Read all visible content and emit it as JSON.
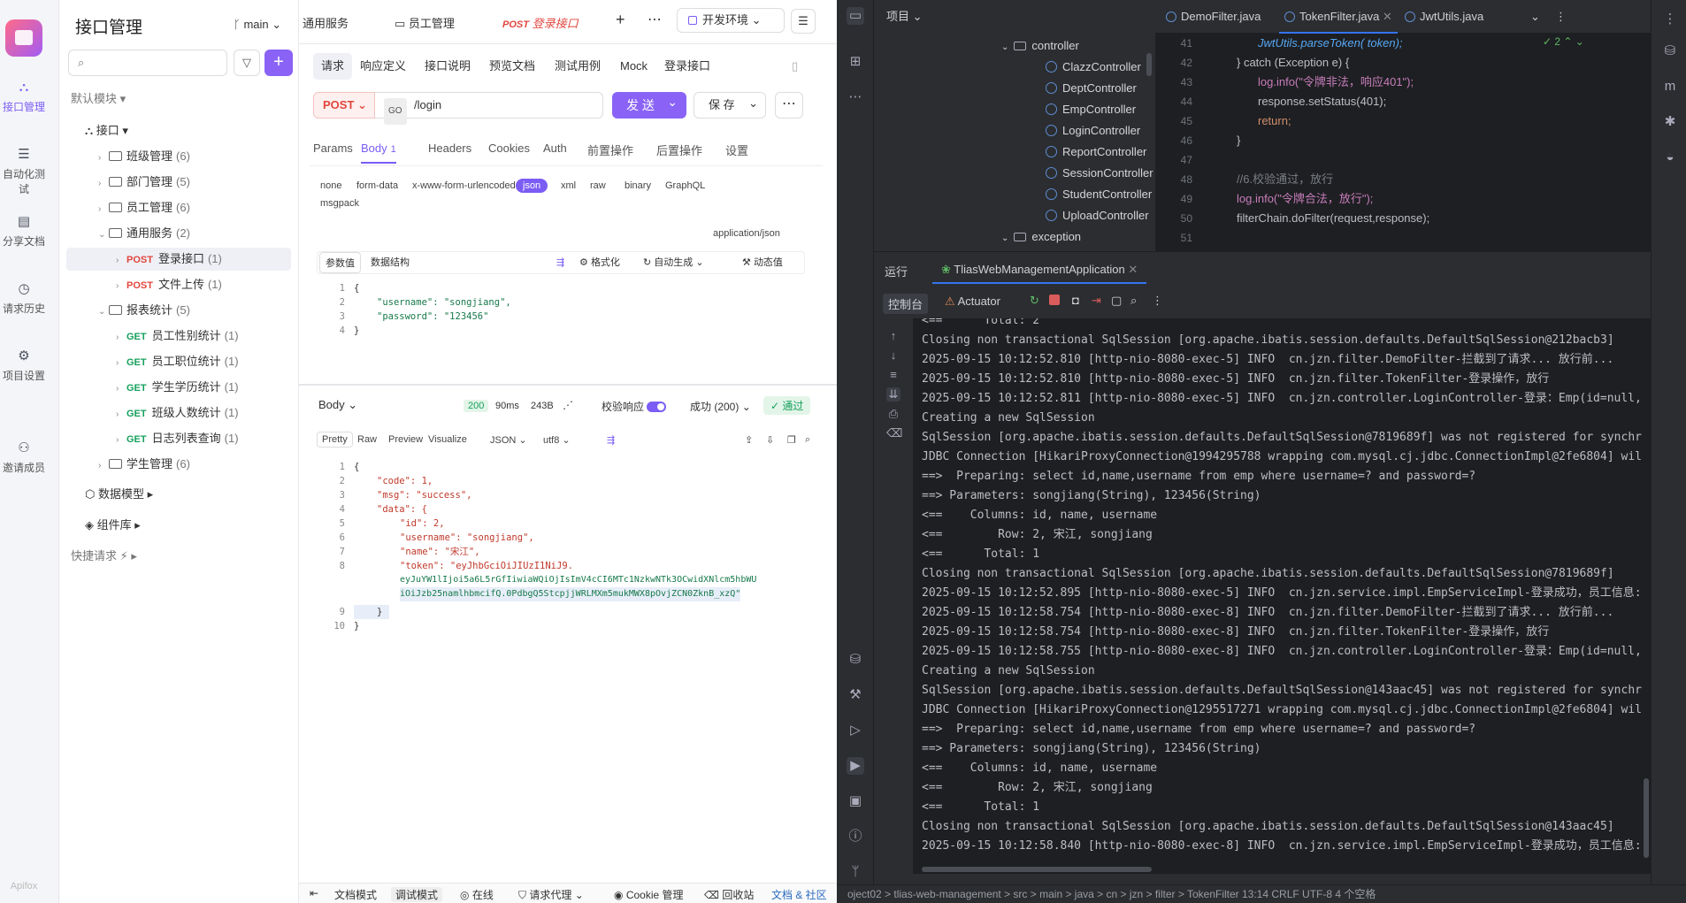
{
  "rail": {
    "items": [
      {
        "label": "接口管理",
        "icon": "api-icon"
      },
      {
        "label": "自动化测试",
        "icon": "test-icon"
      },
      {
        "label": "分享文档",
        "icon": "book-icon"
      },
      {
        "label": "请求历史",
        "icon": "history-icon"
      },
      {
        "label": "项目设置",
        "icon": "gear-icon"
      },
      {
        "label": "邀请成员",
        "icon": "invite-icon"
      }
    ],
    "brand": "Apifox"
  },
  "tree": {
    "title": "接口管理",
    "branch": "main",
    "module": "默认模块",
    "root": "接口",
    "nodes": [
      {
        "label": "班级管理",
        "count": "(6)"
      },
      {
        "label": "部门管理",
        "count": "(5)"
      },
      {
        "label": "员工管理",
        "count": "(6)"
      },
      {
        "label": "通用服务",
        "count": "(2)"
      },
      {
        "method": "POST",
        "label": "登录接口",
        "count": "(1)"
      },
      {
        "method": "POST",
        "label": "文件上传",
        "count": "(1)"
      },
      {
        "label": "报表统计",
        "count": "(5)"
      },
      {
        "method": "GET",
        "label": "员工性别统计",
        "count": "(1)"
      },
      {
        "method": "GET",
        "label": "员工职位统计",
        "count": "(1)"
      },
      {
        "method": "GET",
        "label": "学生学历统计",
        "count": "(1)"
      },
      {
        "method": "GET",
        "label": "班级人数统计",
        "count": "(1)"
      },
      {
        "method": "GET",
        "label": "日志列表查询",
        "count": "(1)"
      },
      {
        "label": "学生管理",
        "count": "(6)"
      }
    ],
    "data_model": "数据模型",
    "components": "组件库",
    "quick": "快捷请求"
  },
  "main": {
    "tabs": [
      "通用服务",
      "员工管理",
      "登录接口"
    ],
    "tab_post": "POST",
    "env": "开发环境",
    "subtabs": [
      "请求",
      "响应定义",
      "接口说明",
      "预览文档",
      "测试用例",
      "Mock",
      "登录接口"
    ],
    "method": "POST",
    "url": "/login",
    "url_tag": "GO",
    "send": "发 送",
    "save": "保 存",
    "ptabs": [
      "Params",
      "Body",
      "Headers",
      "Cookies",
      "Auth",
      "前置操作",
      "后置操作",
      "设置"
    ],
    "body_badge": "1",
    "body_types": [
      "none",
      "form-data",
      "x-www-form-urlencoded",
      "json",
      "xml",
      "raw",
      "binary",
      "GraphQL",
      "msgpack"
    ],
    "content_type": "application/json",
    "body_tools": [
      "参数值",
      "数据结构",
      "格式化",
      "自动生成",
      "动态值"
    ],
    "req_lines": [
      "{",
      "\"username\": \"songjiang\",",
      "\"password\": \"123456\"",
      "}"
    ],
    "res_label": "Body",
    "status": "200",
    "time": "90ms",
    "size": "243B",
    "verify": "校验响应",
    "success": "成功 (200)",
    "pass": "通过",
    "res_tabs": [
      "Pretty",
      "Raw",
      "Preview",
      "Visualize",
      "JSON",
      "utf8"
    ],
    "res_lines": [
      "{",
      "\"code\": 1,",
      "\"msg\": \"success\",",
      "\"data\": {",
      "\"id\": 2,",
      "\"username\": \"songjiang\",",
      "\"name\": \"宋江\",",
      "\"token\": \"eyJhbGciOiJIUzI1NiJ9.",
      "eyJuYW1lIjoi5a6L5rGfIiwiaWQiOjIsImV4cCI6MTc1NzkwNTk3OCwidXNlcm5hbWU",
      "iOiJzb25namlhbmcifQ.0PdbgQ5StcpjjWRLMXm5mukMWX8pOvjZCN0ZknB_xzQ\"",
      "}",
      "}"
    ],
    "bottom": [
      "文档模式",
      "调试模式",
      "在线",
      "请求代理",
      "Cookie 管理",
      "回收站",
      "文档 & 社区"
    ]
  },
  "ide": {
    "project_label": "项目",
    "tree": [
      {
        "label": "controller",
        "kind": "folder"
      },
      {
        "label": "ClazzController",
        "kind": "class"
      },
      {
        "label": "DeptController",
        "kind": "class"
      },
      {
        "label": "EmpController",
        "kind": "class"
      },
      {
        "label": "LoginController",
        "kind": "class"
      },
      {
        "label": "ReportController",
        "kind": "class"
      },
      {
        "label": "SessionController",
        "kind": "class"
      },
      {
        "label": "StudentController",
        "kind": "class"
      },
      {
        "label": "UploadController",
        "kind": "class"
      },
      {
        "label": "exception",
        "kind": "folder"
      }
    ],
    "editor_tabs": [
      "DemoFilter.java",
      "TokenFilter.java",
      "JwtUtils.java"
    ],
    "warn_count": "2",
    "code": [
      {
        "n": "41",
        "t": "JwtUtils.parseToken( token);"
      },
      {
        "n": "42",
        "t": "} catch (Exception e) {"
      },
      {
        "n": "43",
        "t": "log.info(\"令牌非法，响应401\");"
      },
      {
        "n": "44",
        "t": "response.setStatus(401);"
      },
      {
        "n": "45",
        "t": "return;"
      },
      {
        "n": "46",
        "t": "}"
      },
      {
        "n": "47",
        "t": ""
      },
      {
        "n": "48",
        "t": "//6.校验通过，放行"
      },
      {
        "n": "49",
        "t": "log.info(\"令牌合法，放行\");"
      },
      {
        "n": "50",
        "t": "filterChain.doFilter(request,response);"
      },
      {
        "n": "51",
        "t": ""
      }
    ],
    "run_label": "运行",
    "run_config": "TliasWebManagementApplication",
    "console_tab": "控制台",
    "actuator": "Actuator",
    "console": [
      "<==      Total: 2",
      "Closing non transactional SqlSession [org.apache.ibatis.session.defaults.DefaultSqlSession@212bacb3]",
      "2025-09-15 10:12:52.810 [http-nio-8080-exec-5] INFO  cn.jzn.filter.DemoFilter-拦截到了请求... 放行前...",
      "2025-09-15 10:12:52.810 [http-nio-8080-exec-5] INFO  cn.jzn.filter.TokenFilter-登录操作，放行",
      "2025-09-15 10:12:52.811 [http-nio-8080-exec-5] INFO  cn.jzn.controller.LoginController-登录：Emp(id=null,",
      "Creating a new SqlSession",
      "SqlSession [org.apache.ibatis.session.defaults.DefaultSqlSession@7819689f] was not registered for synchr",
      "JDBC Connection [HikariProxyConnection@1994295788 wrapping com.mysql.cj.jdbc.ConnectionImpl@2fe6804] wil",
      "==>  Preparing: select id,name,username from emp where username=? and password=?",
      "==> Parameters: songjiang(String), 123456(String)",
      "<==    Columns: id, name, username",
      "<==        Row: 2, 宋江, songjiang",
      "<==      Total: 1",
      "Closing non transactional SqlSession [org.apache.ibatis.session.defaults.DefaultSqlSession@7819689f]",
      "2025-09-15 10:12:52.895 [http-nio-8080-exec-5] INFO  cn.jzn.service.impl.EmpServiceImpl-登录成功，员工信息:",
      "2025-09-15 10:12:58.754 [http-nio-8080-exec-8] INFO  cn.jzn.filter.DemoFilter-拦截到了请求... 放行前...",
      "2025-09-15 10:12:58.754 [http-nio-8080-exec-8] INFO  cn.jzn.filter.TokenFilter-登录操作，放行",
      "2025-09-15 10:12:58.755 [http-nio-8080-exec-8] INFO  cn.jzn.controller.LoginController-登录：Emp(id=null,",
      "Creating a new SqlSession",
      "SqlSession [org.apache.ibatis.session.defaults.DefaultSqlSession@143aac45] was not registered for synchr",
      "JDBC Connection [HikariProxyConnection@1295517271 wrapping com.mysql.cj.jdbc.ConnectionImpl@2fe6804] wil",
      "==>  Preparing: select id,name,username from emp where username=? and password=?",
      "==> Parameters: songjiang(String), 123456(String)",
      "<==    Columns: id, name, username",
      "<==        Row: 2, 宋江, songjiang",
      "<==      Total: 1",
      "Closing non transactional SqlSession [org.apache.ibatis.session.defaults.DefaultSqlSession@143aac45]",
      "2025-09-15 10:12:58.840 [http-nio-8080-exec-8] INFO  cn.jzn.service.impl.EmpServiceImpl-登录成功，员工信息:"
    ],
    "statusbar": "oject02 > tlias-web-management > src > main > java > cn > jzn > filter > TokenFilter      13:14   CRLF   UTF-8   4 个空格"
  },
  "colors": {
    "accent": "#7b5cf5",
    "post": "#e2463d",
    "get": "#16a05d",
    "ide_bg": "#1e1f22"
  }
}
